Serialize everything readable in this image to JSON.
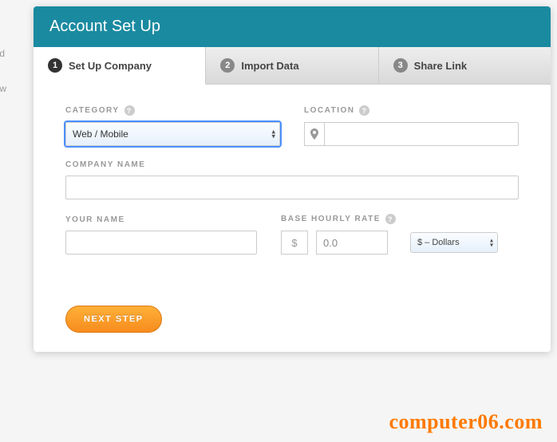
{
  "header": {
    "title": "Account Set Up"
  },
  "tabs": [
    {
      "num": "1",
      "label": "Set Up Company"
    },
    {
      "num": "2",
      "label": "Import Data"
    },
    {
      "num": "3",
      "label": "Share Link"
    }
  ],
  "form": {
    "category": {
      "label": "CATEGORY",
      "value": "Web / Mobile"
    },
    "location": {
      "label": "LOCATION",
      "value": "",
      "icon": "pin"
    },
    "company_name": {
      "label": "COMPANY NAME",
      "value": ""
    },
    "your_name": {
      "label": "YOUR NAME",
      "value": ""
    },
    "rate": {
      "label": "BASE HOURLY RATE",
      "symbol": "$",
      "value": "0.0",
      "currency": "$ – Dollars"
    }
  },
  "footer": {
    "next": "NEXT STEP"
  },
  "watermark": "computer06.com",
  "ghost": {
    "a": "eated",
    "b": "e new"
  }
}
